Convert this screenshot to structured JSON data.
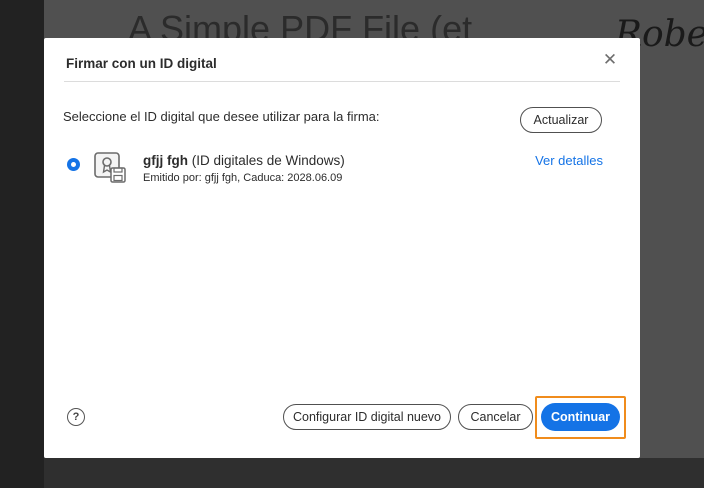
{
  "background_doc": {
    "heading_fragment": "A Simple PDF File  (et",
    "signature_fragment": "Robe"
  },
  "dialog": {
    "title": "Firmar con un ID digital",
    "close_glyph": "✕",
    "prompt": "Seleccione el ID digital que desee utilizar para la firma:",
    "refresh_label": "Actualizar",
    "digital_id": {
      "name": "gfjj fgh",
      "store": "(ID digitales de Windows)",
      "issuer_line": "Emitido por: gfjj fgh, Caduca: 2028.06.09",
      "selected": true,
      "icon": "certificate-icon"
    },
    "details_link": "Ver detalles",
    "help_glyph": "?",
    "configure_label": "Configurar ID digital nuevo",
    "cancel_label": "Cancelar",
    "continue_label": "Continuar"
  },
  "colors": {
    "accent": "#1473e6",
    "highlight": "#f08c1c"
  }
}
